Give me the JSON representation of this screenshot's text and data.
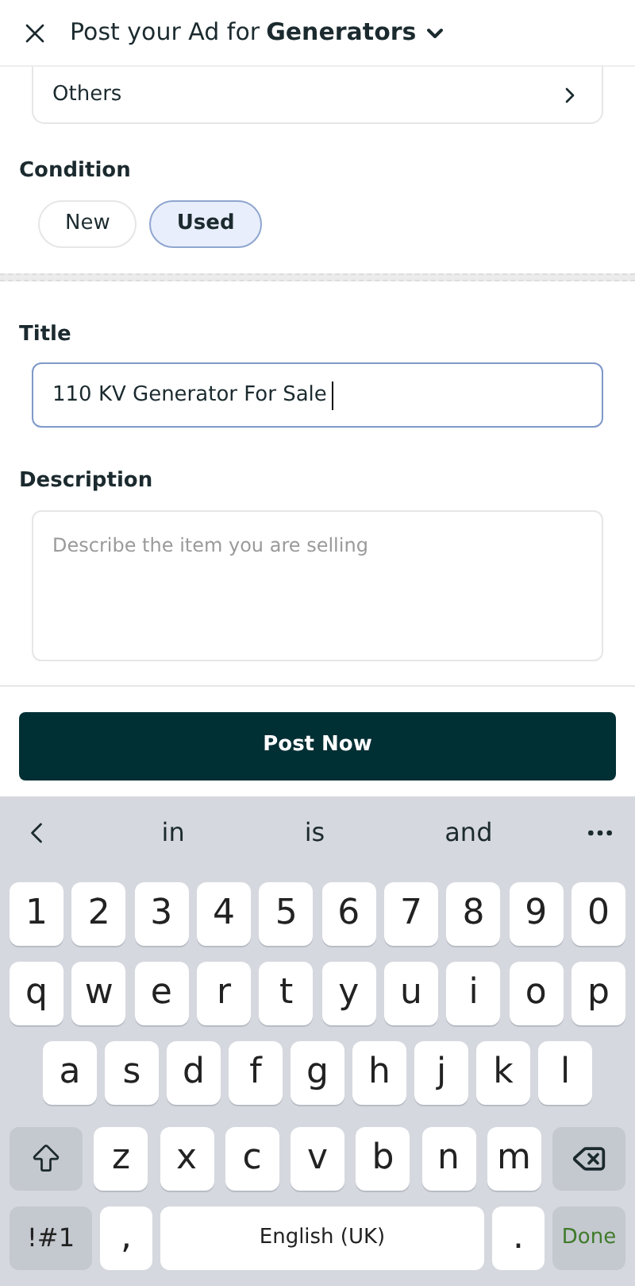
{
  "header": {
    "title": "Post your Ad for",
    "category": "Generators"
  },
  "others_row": {
    "label": "Others"
  },
  "condition": {
    "label": "Condition",
    "options": [
      {
        "label": "New",
        "selected": false
      },
      {
        "label": "Used",
        "selected": true
      }
    ]
  },
  "title_field": {
    "label": "Title",
    "value": "110 KV Generator For Sale"
  },
  "description_field": {
    "label": "Description",
    "placeholder": "Describe the item you are selling"
  },
  "post_button": {
    "label": "Post Now"
  },
  "keyboard": {
    "suggestions": [
      "in",
      "is",
      "and"
    ],
    "rows": [
      [
        {
          "kind": "char",
          "label": "1"
        },
        {
          "kind": "char",
          "label": "2"
        },
        {
          "kind": "char",
          "label": "3"
        },
        {
          "kind": "char",
          "label": "4"
        },
        {
          "kind": "char",
          "label": "5"
        },
        {
          "kind": "char",
          "label": "6"
        },
        {
          "kind": "char",
          "label": "7"
        },
        {
          "kind": "char",
          "label": "8"
        },
        {
          "kind": "char",
          "label": "9"
        },
        {
          "kind": "char",
          "label": "0"
        }
      ],
      [
        {
          "kind": "char",
          "label": "q"
        },
        {
          "kind": "char",
          "label": "w"
        },
        {
          "kind": "char",
          "label": "e"
        },
        {
          "kind": "char",
          "label": "r"
        },
        {
          "kind": "char",
          "label": "t"
        },
        {
          "kind": "char",
          "label": "y"
        },
        {
          "kind": "char",
          "label": "u"
        },
        {
          "kind": "char",
          "label": "i"
        },
        {
          "kind": "char",
          "label": "o"
        },
        {
          "kind": "char",
          "label": "p"
        }
      ],
      [
        {
          "kind": "char",
          "label": "a"
        },
        {
          "kind": "char",
          "label": "s"
        },
        {
          "kind": "char",
          "label": "d"
        },
        {
          "kind": "char",
          "label": "f"
        },
        {
          "kind": "char",
          "label": "g"
        },
        {
          "kind": "char",
          "label": "h"
        },
        {
          "kind": "char",
          "label": "j"
        },
        {
          "kind": "char",
          "label": "k"
        },
        {
          "kind": "char",
          "label": "l"
        }
      ],
      [
        {
          "kind": "shift"
        },
        {
          "kind": "char",
          "label": "z"
        },
        {
          "kind": "char",
          "label": "x"
        },
        {
          "kind": "char",
          "label": "c"
        },
        {
          "kind": "char",
          "label": "v"
        },
        {
          "kind": "char",
          "label": "b"
        },
        {
          "kind": "char",
          "label": "n"
        },
        {
          "kind": "char",
          "label": "m"
        },
        {
          "kind": "backspace"
        }
      ]
    ],
    "bottom_bar": {
      "symbols_key": "!#1",
      "comma_key": ",",
      "space_key": "English (UK)",
      "period_key": ".",
      "done_key": {
        "label": "Done",
        "disabled": true
      }
    }
  }
}
